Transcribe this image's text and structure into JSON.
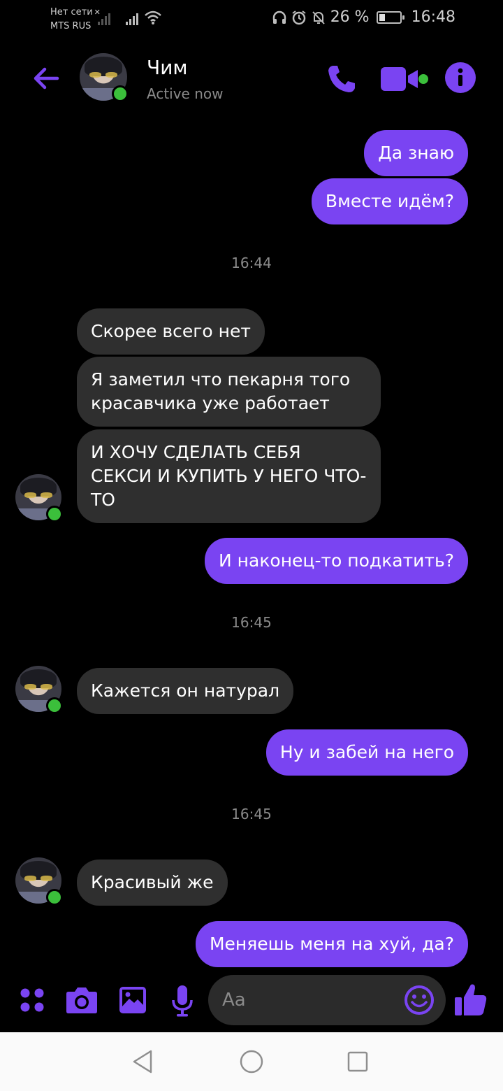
{
  "status_bar": {
    "carrier_line1": "Нет сети",
    "carrier_line2": "MTS RUS",
    "battery": "26 %",
    "battery_level": 0.26,
    "time": "16:48"
  },
  "header": {
    "contact_name": "Чим",
    "status": "Active now"
  },
  "messages": [
    {
      "type": "out",
      "text": "Да знаю"
    },
    {
      "type": "out",
      "text": "Вместе идём?"
    },
    {
      "type": "time",
      "text": "16:44"
    },
    {
      "type": "in",
      "text": "Скорее всего нет"
    },
    {
      "type": "in",
      "text": "Я заметил что пекарня того красавчика уже работает"
    },
    {
      "type": "in",
      "text": "И ХОЧУ СДЕЛАТЬ СЕБЯ СЕКСИ И КУПИТЬ У НЕГО ЧТО-ТО"
    },
    {
      "type": "out",
      "text": "И наконец-то подкатить?"
    },
    {
      "type": "time",
      "text": "16:45"
    },
    {
      "type": "in",
      "text": "Кажется он натурал"
    },
    {
      "type": "out",
      "text": "Ну и забей на него"
    },
    {
      "type": "time",
      "text": "16:45"
    },
    {
      "type": "in",
      "text": "Красивый же"
    },
    {
      "type": "out",
      "text": "Меняешь меня на хуй, да?"
    }
  ],
  "composer": {
    "placeholder": "Aa"
  },
  "colors": {
    "accent": "#7a44f2",
    "incoming_bubble": "#2f2f2f",
    "online": "#3bbf3b"
  },
  "icons": [
    "back-arrow-icon",
    "phone-icon",
    "video-icon",
    "info-icon",
    "apps-icon",
    "camera-icon",
    "gallery-icon",
    "microphone-icon",
    "emoji-icon",
    "thumbs-up-icon",
    "nav-back-icon",
    "nav-home-icon",
    "nav-recents-icon"
  ]
}
